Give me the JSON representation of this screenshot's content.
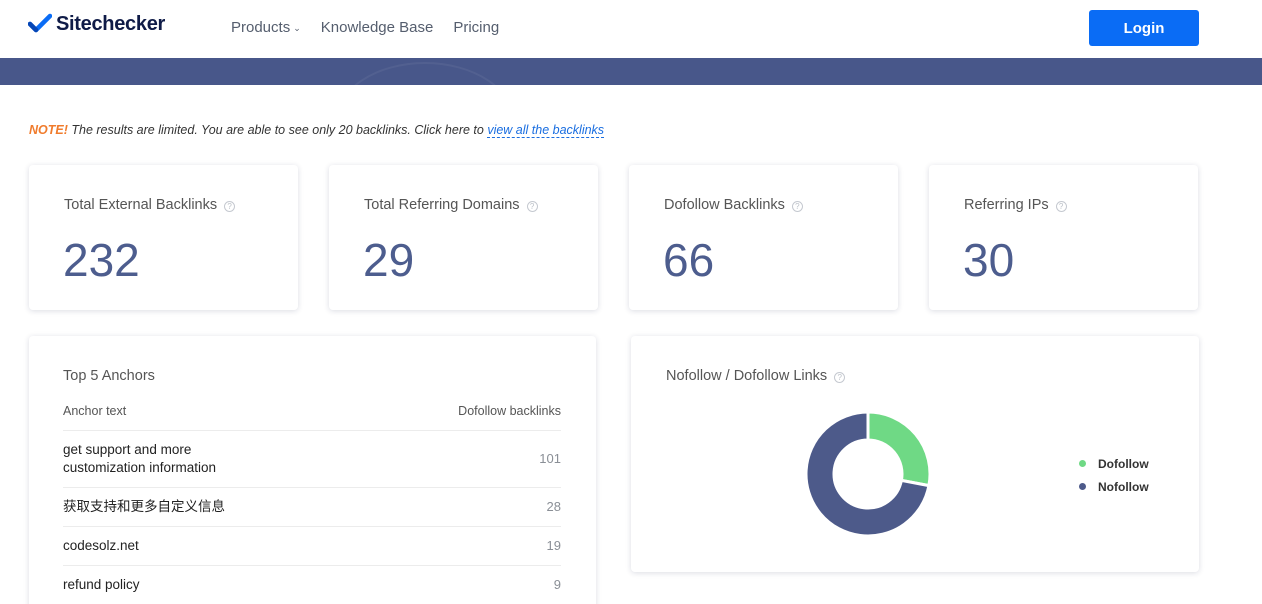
{
  "header": {
    "logo_text": "Sitechecker",
    "nav": [
      {
        "label": "Products",
        "caret": true
      },
      {
        "label": "Knowledge Base",
        "caret": false
      },
      {
        "label": "Pricing",
        "caret": false
      }
    ],
    "login_label": "Login"
  },
  "note": {
    "prefix": "NOTE!",
    "text": " The results are limited. You are able to see only 20 backlinks. Click here to ",
    "link": "view all the backlinks"
  },
  "stats": [
    {
      "label": "Total External Backlinks",
      "value": "232"
    },
    {
      "label": "Total Referring Domains",
      "value": "29"
    },
    {
      "label": "Dofollow Backlinks",
      "value": "66"
    },
    {
      "label": "Referring IPs",
      "value": "30"
    }
  ],
  "anchors": {
    "title": "Top 5 Anchors",
    "col_anchor": "Anchor text",
    "col_count": "Dofollow backlinks",
    "rows": [
      {
        "anchor": "get support and more customization information",
        "count": "101"
      },
      {
        "anchor": "获取支持和更多自定义信息",
        "count": "28"
      },
      {
        "anchor": "codesolz.net",
        "count": "19"
      },
      {
        "anchor": "refund policy",
        "count": "9"
      }
    ]
  },
  "links_chart": {
    "title": "Nofollow / Dofollow Links",
    "legend": [
      {
        "label": "Dofollow",
        "color": "#6fd985"
      },
      {
        "label": "Nofollow",
        "color": "#4d5a8a"
      }
    ]
  },
  "chart_data": {
    "type": "pie",
    "title": "Nofollow / Dofollow Links",
    "categories": [
      "Dofollow",
      "Nofollow"
    ],
    "values": [
      0.28,
      0.72
    ],
    "colors": [
      "#6fd985",
      "#4d5a8a"
    ],
    "legend": "right"
  },
  "colors": {
    "brand": "#0a6cf5",
    "band": "#48578a",
    "stat_value": "#4d5d8e",
    "note_accent": "#f07b2c"
  }
}
